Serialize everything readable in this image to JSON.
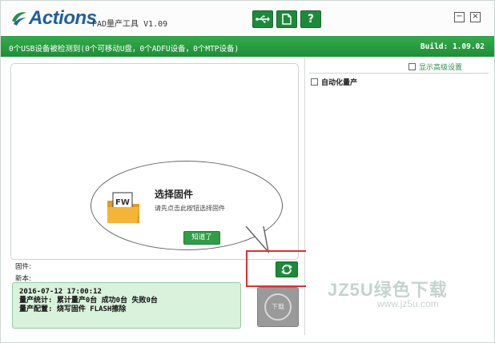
{
  "titlebar": {
    "logo_text": "Actions",
    "app_title": "PAD量产工具 V1.09",
    "buttons": [
      {
        "icon": "usb-icon"
      },
      {
        "icon": "document-icon"
      },
      {
        "icon": "help-icon",
        "label": "?"
      }
    ],
    "minimize_label": "−",
    "close_label": "×"
  },
  "statusbar": {
    "text": "0个USB设备被检测到(0个可移动U盘，0个ADFU设备，0个MTP设备)",
    "build": "Build: 1.09.02"
  },
  "bubble": {
    "title": "选择固件",
    "subtitle": "请先点击此按钮选择固件",
    "confirm_label": "知道了",
    "folder_label": "FW"
  },
  "info": {
    "firmware_label": "固件:",
    "version_label": "新本:"
  },
  "log": {
    "lines": [
      "2016-07-12 17:00:12",
      "量产统计:  累计量产0台 成功0台 失败0台",
      "量产配置:  烧写固件 FLASH擦除"
    ]
  },
  "download_label": "下载",
  "right": {
    "advanced_label": "显示高级设置",
    "auto_label": "自动化量产"
  },
  "watermark": {
    "main": "JZ5U绿色下载",
    "sub": "www.jz5u.com"
  },
  "colors": {
    "accent": "#1d8a3a",
    "status_bg": "#2a9b43",
    "log_bg": "#d9f2dc",
    "highlight": "#e03030"
  }
}
